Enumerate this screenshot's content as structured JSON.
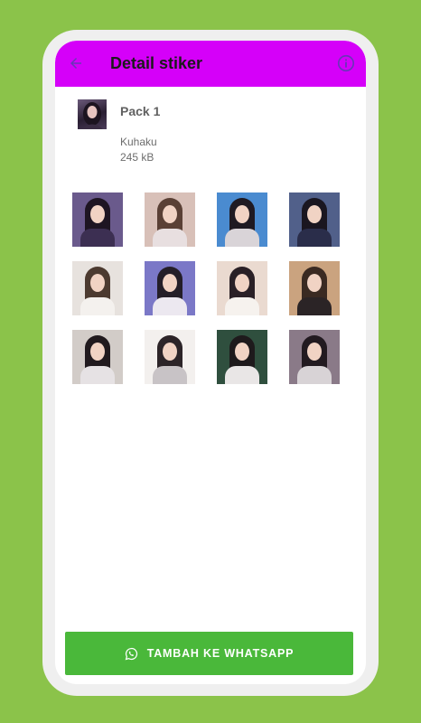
{
  "app_bar": {
    "title": "Detail stiker",
    "back_icon": "arrow-left-icon",
    "info_icon": "info-icon",
    "color": "#d500f9"
  },
  "pack": {
    "name": "Pack 1",
    "author": "Kuhaku",
    "size": "245 kB"
  },
  "stickers": [
    {
      "bg": "#6a5a8c",
      "hair": "#1e1522",
      "body": "#3c2f52"
    },
    {
      "bg": "#d8c0b8",
      "hair": "#5a4035",
      "body": "#e8dfe0"
    },
    {
      "bg": "#4a8bd0",
      "hair": "#1f1a22",
      "body": "#d9d4d8"
    },
    {
      "bg": "#51608a",
      "hair": "#1a1620",
      "body": "#2a2d4a"
    },
    {
      "bg": "#e7e2de",
      "hair": "#4c3a30",
      "body": "#f4f1ee"
    },
    {
      "bg": "#7b78c7",
      "hair": "#241e28",
      "body": "#ece8f0"
    },
    {
      "bg": "#eadad0",
      "hair": "#2a2026",
      "body": "#f6f2ee"
    },
    {
      "bg": "#caa37f",
      "hair": "#3a2a22",
      "body": "#2b2426"
    },
    {
      "bg": "#d2ccc8",
      "hair": "#211a1e",
      "body": "#e6e2e4"
    },
    {
      "bg": "#f3f0ee",
      "hair": "#2c2428",
      "body": "#c8c3c6"
    },
    {
      "bg": "#2f4f3e",
      "hair": "#1e1a1c",
      "body": "#e9e6e6"
    },
    {
      "bg": "#8a7a88",
      "hair": "#221a20",
      "body": "#d8d3d6"
    }
  ],
  "add_button": {
    "label": "TAMBAH KE WHATSAPP",
    "icon": "whatsapp-icon",
    "color": "#4ab83a"
  },
  "colors": {
    "background": "#8bc34a"
  }
}
